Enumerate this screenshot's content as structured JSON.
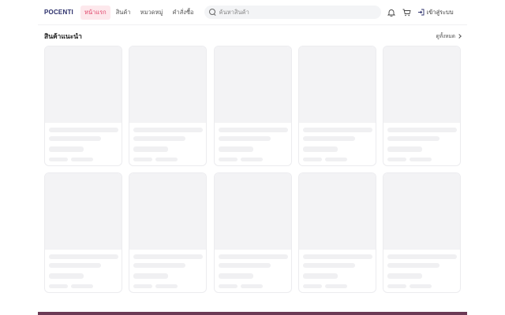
{
  "header": {
    "logo": "POCENTI",
    "nav": [
      {
        "label": "หน้าแรก",
        "active": true
      },
      {
        "label": "สินค้า",
        "active": false
      },
      {
        "label": "หมวดหมู่",
        "active": false
      },
      {
        "label": "คำสั่งซื้อ",
        "active": false
      }
    ],
    "search": {
      "placeholder": "ค้นหาสินค้า",
      "value": ""
    },
    "login_label": "เข้าสู่ระบบ"
  },
  "section": {
    "title": "สินค้าแนะนำ",
    "view_all": "ดูทั้งหมด"
  },
  "products": {
    "count": 10,
    "state": "loading-skeleton"
  },
  "colors": {
    "accent": "#e0446a",
    "accent_bg": "#fde8ec",
    "brand": "#2b2f6b",
    "footer": "#6b3a55"
  }
}
